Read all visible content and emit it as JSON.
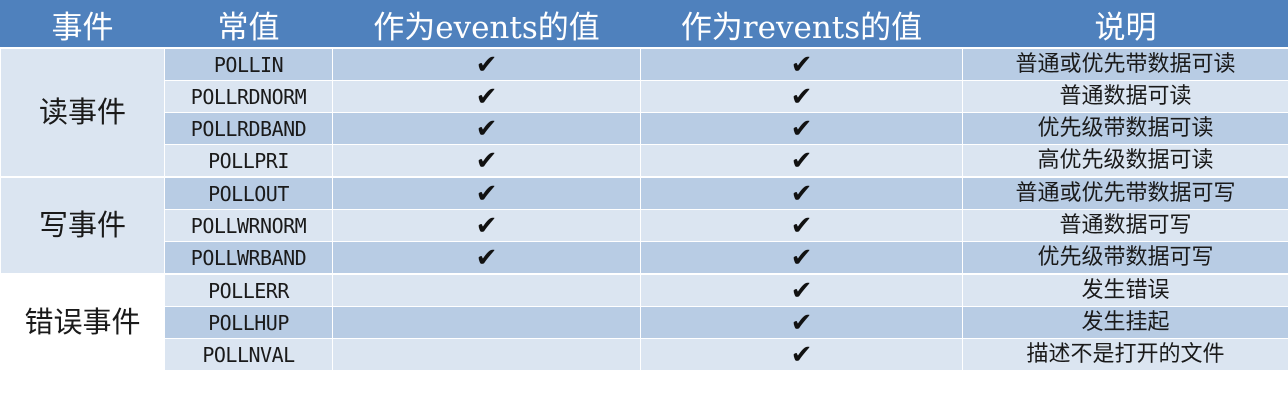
{
  "header": {
    "event": "事件",
    "constant": "常值",
    "as_events": "作为events的值",
    "as_revents": "作为revents的值",
    "description": "说明"
  },
  "check_mark": "✔",
  "groups": [
    {
      "label": "读事件",
      "rows": [
        {
          "constant": "POLLIN",
          "events": true,
          "revents": true,
          "desc": "普通或优先带数据可读"
        },
        {
          "constant": "POLLRDNORM",
          "events": true,
          "revents": true,
          "desc": "普通数据可读"
        },
        {
          "constant": "POLLRDBAND",
          "events": true,
          "revents": true,
          "desc": "优先级带数据可读"
        },
        {
          "constant": "POLLPRI",
          "events": true,
          "revents": true,
          "desc": "高优先级数据可读"
        }
      ]
    },
    {
      "label": "写事件",
      "rows": [
        {
          "constant": "POLLOUT",
          "events": true,
          "revents": true,
          "desc": "普通或优先带数据可写"
        },
        {
          "constant": "POLLWRNORM",
          "events": true,
          "revents": true,
          "desc": "普通数据可写"
        },
        {
          "constant": "POLLWRBAND",
          "events": true,
          "revents": true,
          "desc": "优先级带数据可写"
        }
      ]
    },
    {
      "label": "错误事件",
      "rows": [
        {
          "constant": "POLLERR",
          "events": false,
          "revents": true,
          "desc": "发生错误"
        },
        {
          "constant": "POLLHUP",
          "events": false,
          "revents": true,
          "desc": "发生挂起"
        },
        {
          "constant": "POLLNVAL",
          "events": false,
          "revents": true,
          "desc": "描述不是打开的文件"
        }
      ]
    }
  ],
  "colors": {
    "header_bg": "#4f81bd",
    "band": "#b8cce4",
    "plain": "#dbe5f1"
  }
}
